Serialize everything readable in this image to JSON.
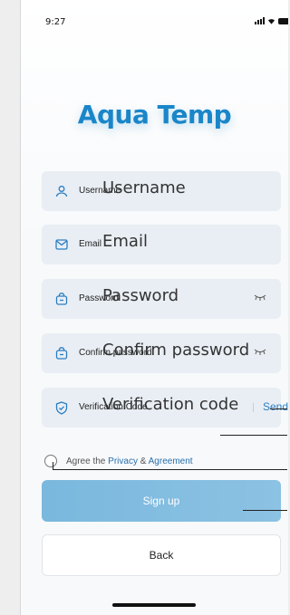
{
  "status_bar": {
    "time": "9:27"
  },
  "app": {
    "title": "Aqua Temp"
  },
  "form": {
    "username": {
      "icon": "user-icon",
      "small_label": "Username",
      "big_label": "Username"
    },
    "email": {
      "icon": "mail-icon",
      "small_label": "Email",
      "big_label": "Email"
    },
    "password": {
      "icon": "lock-icon",
      "small_label": "Password",
      "big_label": "Password",
      "eye_icon": "eye-closed-icon"
    },
    "confirm_password": {
      "icon": "lock-icon",
      "small_label": "Confirm password",
      "big_label": "Confirm password",
      "eye_icon": "eye-closed-icon"
    },
    "verification": {
      "icon": "shield-check-icon",
      "small_label": "Verification Code",
      "big_label": "Verification code",
      "send_label": "Send"
    }
  },
  "agreement": {
    "prefix": "Agree the ",
    "privacy": "Privacy",
    "amp": " & ",
    "agreement": "Agreement"
  },
  "buttons": {
    "signup": "Sign up",
    "back": "Back"
  },
  "colors": {
    "brand": "#1a86c9",
    "signup_bg": "#7ab8dd",
    "link": "#2a6fae"
  }
}
